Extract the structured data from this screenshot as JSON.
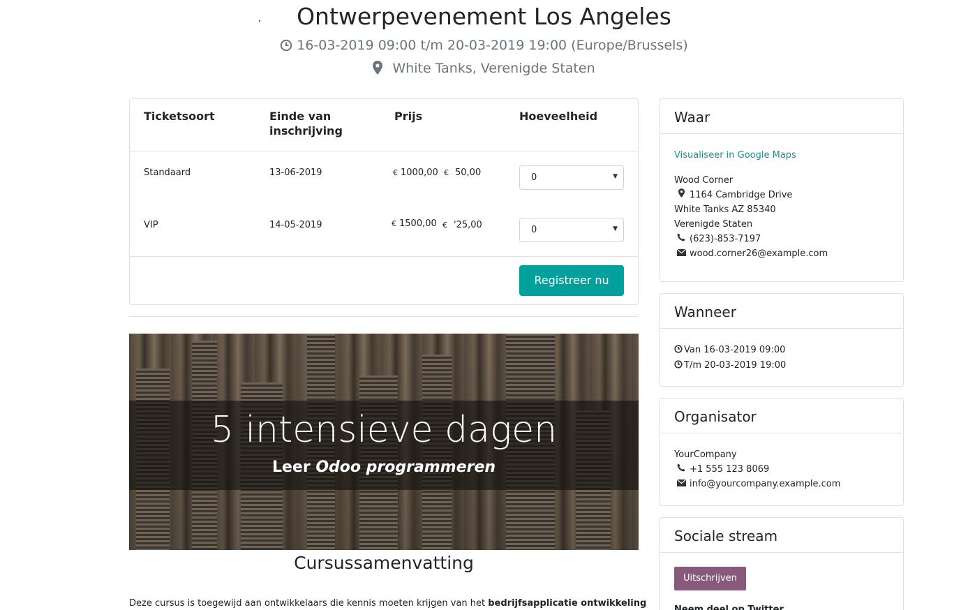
{
  "event": {
    "title": "Ontwerpevenement Los Angeles",
    "date_range": "16-03-2019 09:00 t/m 20-03-2019 19:00 (Europe/Brussels)",
    "location": "White Tanks, Verenigde Staten"
  },
  "tickets": {
    "headers": {
      "type": "Ticketsoort",
      "end_line1": "Einde van",
      "end_line2": "inschrijving",
      "price": "Prijs",
      "qty": "Hoeveelheid"
    },
    "rows": [
      {
        "type": "Standaard",
        "end": "13-06-2019",
        "currency": "€",
        "old_price": "1000,00",
        "new_price": "50,00",
        "qty": "0"
      },
      {
        "type": "VIP",
        "end": "14-05-2019",
        "currency": "€",
        "old_price": "1500,00",
        "new_price": "'25,00",
        "qty": "0"
      }
    ],
    "register_label": "Registreer nu"
  },
  "banner": {
    "title": "5 intensieve dagen",
    "sub_prefix": "Leer ",
    "sub_emphasis": "Odoo programmeren"
  },
  "summary": {
    "title": "Cursussamenvatting",
    "text_prefix": "Deze cursus is toegewijd aan ontwikkelaars die kennis moeten krijgen van het ",
    "text_bold": "bedrijfsapplicatie ontwikkeling"
  },
  "where": {
    "title": "Waar",
    "maps_link": "Visualiseer in Google Maps",
    "name": "Wood Corner",
    "street": "1164 Cambridge Drive",
    "city": "White Tanks AZ 85340",
    "country": "Verenigde Staten",
    "phone": "(623)-853-7197",
    "email": "wood.corner26@example.com"
  },
  "when": {
    "title": "Wanneer",
    "from": "Van 16-03-2019 09:00",
    "to": "T/m 20-03-2019 19:00"
  },
  "organizer": {
    "title": "Organisator",
    "name": "YourCompany",
    "phone": "+1 555 123 8069",
    "email": "info@yourcompany.example.com"
  },
  "social": {
    "title": "Sociale stream",
    "unsubscribe_label": "Uitschrijven",
    "twitter_heading": "Neem deel op Twitter"
  },
  "colors": {
    "primary": "#00a09d",
    "unsubscribe": "#875a7b",
    "link": "#1e8c96",
    "muted": "#6c757d"
  },
  "icons": [
    "clock-icon",
    "map-marker-icon",
    "phone-icon",
    "envelope-icon",
    "caret-down-icon"
  ]
}
